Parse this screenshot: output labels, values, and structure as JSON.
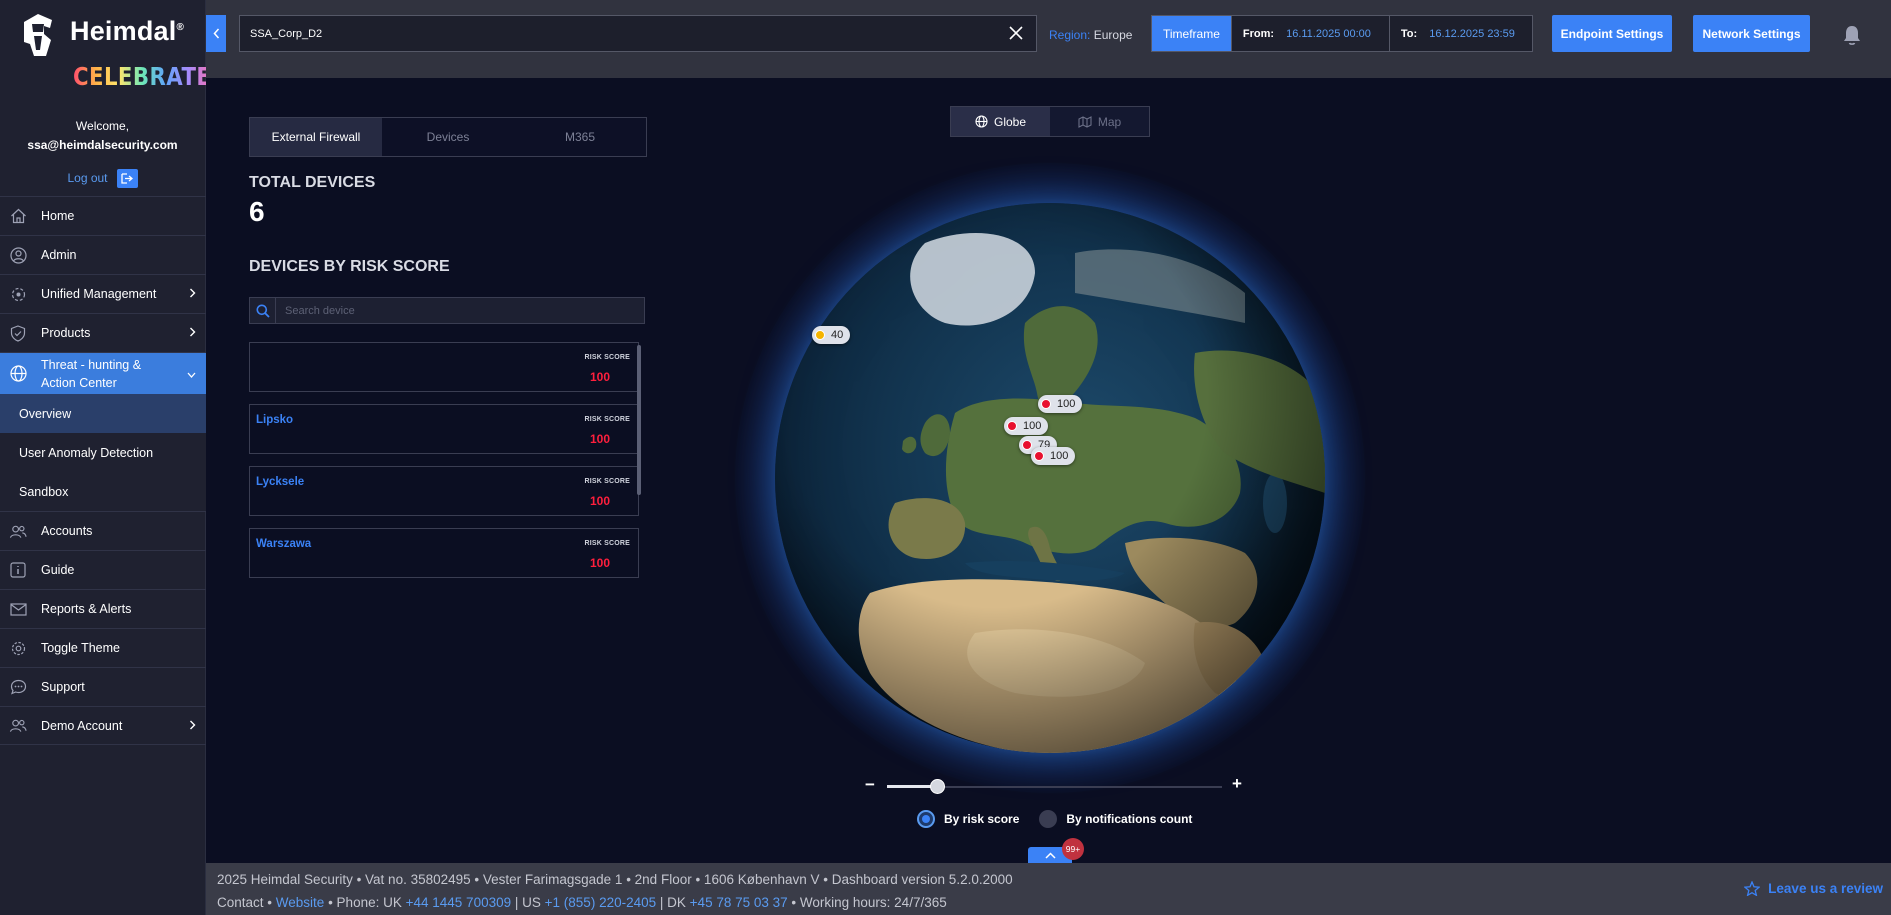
{
  "brand": {
    "name": "Heimdal",
    "reg": "®",
    "celebrate": "CELEBRATE"
  },
  "user": {
    "welcome": "Welcome,",
    "email": "ssa@heimdalsecurity.com",
    "logout": "Log out"
  },
  "nav": {
    "home": "Home",
    "admin": "Admin",
    "unified": "Unified Management",
    "products": "Products",
    "threat": "Threat - hunting & Action Center",
    "overview": "Overview",
    "uad": "User Anomaly Detection",
    "sandbox": "Sandbox",
    "accounts": "Accounts",
    "guide": "Guide",
    "reports": "Reports & Alerts",
    "theme": "Toggle Theme",
    "support": "Support",
    "demo": "Demo Account"
  },
  "topbar": {
    "search_value": "SSA_Corp_D2",
    "region_label": "Region:",
    "region_value": "Europe",
    "timeframe_label": "Timeframe",
    "from_label": "From:",
    "from_value": "16.11.2025 00:00",
    "to_label": "To:",
    "to_value": "16.12.2025 23:59",
    "endpoint_settings": "Endpoint Settings",
    "network_settings": "Network Settings"
  },
  "tabs": [
    "External Firewall",
    "Devices",
    "M365"
  ],
  "stats": {
    "total_label": "TOTAL DEVICES",
    "total_value": "6",
    "risk_label": "DEVICES BY RISK SCORE"
  },
  "device_search": {
    "placeholder": "Search device"
  },
  "devices": [
    {
      "name": "",
      "score_label": "RISK SCORE",
      "score": "100"
    },
    {
      "name": "Lipsko",
      "score_label": "RISK SCORE",
      "score": "100"
    },
    {
      "name": "Lycksele",
      "score_label": "RISK SCORE",
      "score": "100"
    },
    {
      "name": "Warszawa",
      "score_label": "RISK SCORE",
      "score": "100"
    }
  ],
  "view_toggle": {
    "globe": "Globe",
    "map": "Map"
  },
  "markers": [
    {
      "value": "40",
      "color": "#f5b400"
    },
    {
      "value": "100",
      "color": "#e8102f"
    },
    {
      "value": "100",
      "color": "#e8102f"
    },
    {
      "value": "79",
      "color": "#e8102f"
    },
    {
      "value": "100",
      "color": "#e8102f"
    }
  ],
  "zoom": {
    "minus": "−",
    "plus": "+",
    "level": 0.15
  },
  "radios": {
    "risk": "By risk score",
    "notif": "By notifications count"
  },
  "notif_badge": "99+",
  "footer": {
    "line1": "2025 Heimdal Security • Vat no. 35802495 • Vester Farimagsgade 1 • 2nd Floor • 1606 København V • Dashboard version 5.2.0.2000",
    "contact": "Contact •",
    "website": "Website",
    "phone_uk_label": "• Phone: UK",
    "phone_uk": "+44 1445 700309",
    "us_label": "| US",
    "phone_us": "+1 (855) 220-2405",
    "dk_label": "| DK",
    "phone_dk": "+45 78 75 03 37",
    "hours": "• Working hours: 24/7/365",
    "review": "Leave us a review"
  },
  "colors": {
    "accent": "#3b82f6",
    "risk_high": "#ff1f3d",
    "risk_medium": "#f5b400"
  }
}
